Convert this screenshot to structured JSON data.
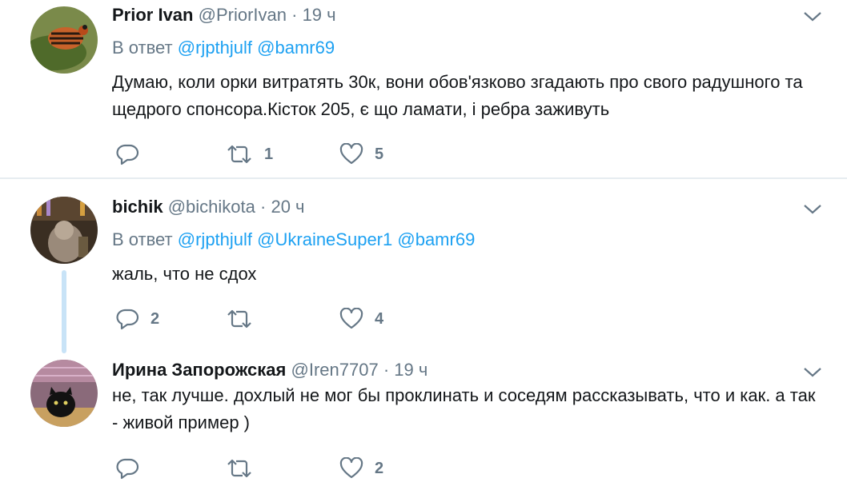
{
  "tweets": [
    {
      "name": "Prior Ivan",
      "handle": "@PriorIvan",
      "dot": "·",
      "time": "19 ч",
      "reply_prefix": "В ответ",
      "mentions": [
        "@rjpthjulf",
        "@bamr69"
      ],
      "text": "Думаю, коли орки витратять 30к, вони обов'язково згадають про свого радушного та щедрого спонсора.Кісток 205, є що ламати, і ребра заживуть",
      "reply_count": "",
      "retweet_count": "1",
      "like_count": "5"
    },
    {
      "name": "bichik",
      "handle": "@bichikota",
      "dot": "·",
      "time": "20 ч",
      "reply_prefix": "В ответ",
      "mentions": [
        "@rjpthjulf",
        "@UkraineSuper1",
        "@bamr69"
      ],
      "text": "жаль, что не сдох",
      "reply_count": "2",
      "retweet_count": "",
      "like_count": "4"
    },
    {
      "name": "Ирина Запорожская",
      "handle": "@Iren7707",
      "dot": "·",
      "time": "19 ч",
      "text": "не, так лучше. дохлый не мог бы проклинать и соседям рассказывать, что и как. а так - живой пример )",
      "reply_count": "",
      "retweet_count": "",
      "like_count": "2"
    }
  ],
  "colors": {
    "link": "#1da1f2",
    "secondary": "#657786",
    "text": "#14171a",
    "thread_line": "#c8e3f7"
  },
  "icons": [
    "reply-icon",
    "retweet-icon",
    "like-icon",
    "chevron-down-icon"
  ]
}
